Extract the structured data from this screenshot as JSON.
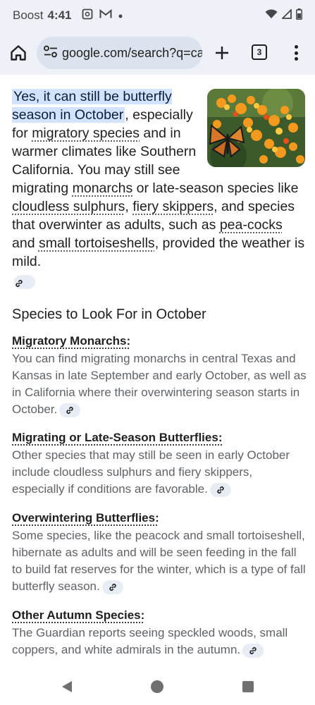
{
  "status_bar": {
    "carrier": "Boost",
    "time": "4:41",
    "icons_left": [
      "screenshot-icon",
      "gmail-icon",
      "dot-icon"
    ],
    "icons_right": [
      "wifi-icon",
      "signal-icon",
      "battery-icon"
    ]
  },
  "browser": {
    "url": "google.com/search?q=ca",
    "tab_count": "3"
  },
  "answer": {
    "highlight": "Yes, it can still be butterfly season in October",
    "t1": ", especially for ",
    "l1": "migratory species",
    "t2": " and in warmer climates like Southern California. You may still see migrating ",
    "l2": "monarchs",
    "t3": " or late-season species like ",
    "l3": "cloudless sulphurs",
    "t4": ", ",
    "l4": "fiery skippers",
    "t5": ", and species that overwinter as adults, such as ",
    "l5": "pea-cocks",
    "t6": " and ",
    "l6": "small tortoiseshells",
    "t7": ", provided the weather is mild."
  },
  "section_heading": "Species to Look For in October",
  "species": [
    {
      "title": "Migratory Monarchs:",
      "body": "You can find migrating monarchs in central Texas and Kansas in late September and early October, as well as in California where their overwintering season starts in October."
    },
    {
      "title": "Migrating or Late-Season Butterflies:",
      "body": "Other species that may still be seen in early October include cloudless sulphurs and fiery skippers, especially if conditions are favorable."
    },
    {
      "title": "Overwintering Butterflies:",
      "body": "Some species, like the peacock and small tortoiseshell, hibernate as adults and will be seen feeding in the fall to build fat reserves for the winter, which is a type of fall butterfly season."
    },
    {
      "title": "Other Autumn Species:",
      "body": "The Guardian reports seeing speckled woods, small coppers, and white admirals in the autumn."
    }
  ],
  "colors": {
    "chrome_bg": "#eef1f8",
    "highlight_bg": "#d3e3fd",
    "chip_bg": "#e8ecf5",
    "body_gray": "#5f6368"
  }
}
